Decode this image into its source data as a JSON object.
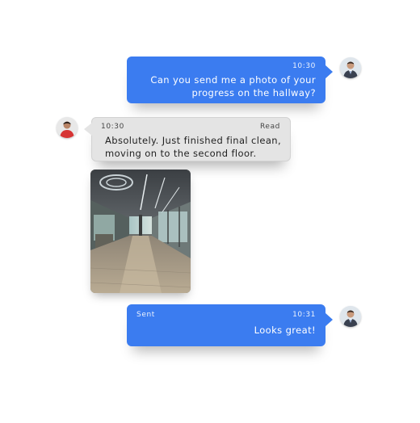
{
  "messages": [
    {
      "direction": "outgoing",
      "time": "10:30",
      "lines": [
        "Can you send me a photo of your",
        "progress on the hallway?"
      ]
    },
    {
      "direction": "incoming",
      "time": "10:30",
      "status": "Read",
      "lines": [
        "Absolutely. Just finished final clean,",
        "moving on to the second floor."
      ]
    },
    {
      "direction": "incoming",
      "type": "photo",
      "photo_subject": "hallway-photo"
    },
    {
      "direction": "outgoing",
      "time": "10:31",
      "status": "Sent",
      "lines": [
        "Looks great!"
      ]
    }
  ],
  "colors": {
    "outgoing_bubble": "#3b7cf0",
    "incoming_bubble": "#e4e4e4",
    "outgoing_text": "#ffffff",
    "incoming_text": "#2a2a2a"
  },
  "icons": {
    "sender_avatar": "user-avatar-icon",
    "contact_avatar": "contact-avatar-icon"
  }
}
